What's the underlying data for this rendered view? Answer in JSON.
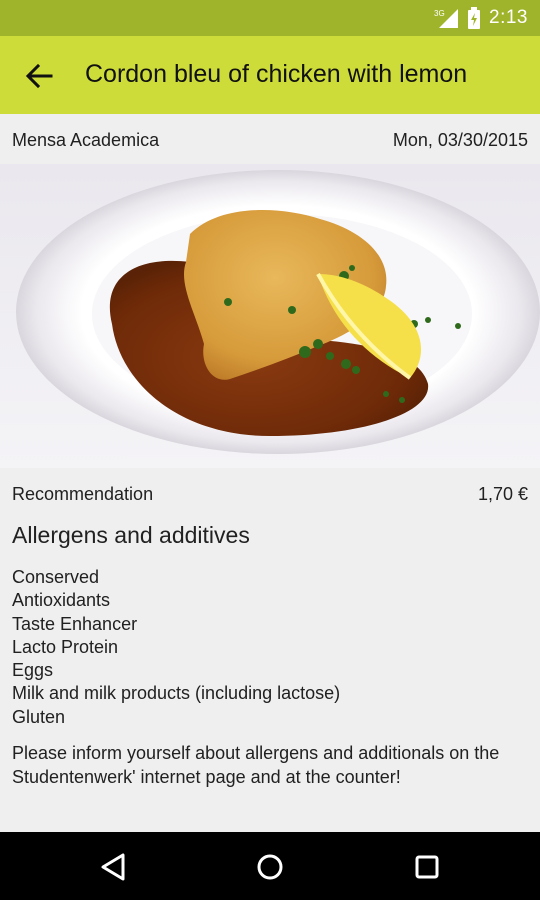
{
  "status_bar": {
    "time": "2:13",
    "network": "3G",
    "icons": [
      "signal-icon",
      "battery-icon"
    ]
  },
  "app_bar": {
    "title": "Cordon bleu of chicken with lemon",
    "back_icon": "arrow-back-icon"
  },
  "meal": {
    "location": "Mensa Academica",
    "date": "Mon, 03/30/2015",
    "category": "Recommendation",
    "price": "1,70 €"
  },
  "allergens": {
    "heading": "Allergens and additives",
    "items": [
      "Conserved",
      "Antioxidants",
      "Taste Enhancer",
      "Lacto Protein",
      "Eggs",
      "Milk and milk products (including lactose)",
      "Gluten"
    ],
    "notice": "Please inform yourself about allergens and additionals on the Studentenwerk' internet page and at the counter!"
  },
  "nav_bar": {
    "buttons": [
      "back-triangle-icon",
      "home-circle-icon",
      "recents-square-icon"
    ]
  },
  "colors": {
    "status_bar": "#9fb42a",
    "app_bar": "#cddc39",
    "background": "#efefef",
    "nav_bar": "#000000"
  }
}
